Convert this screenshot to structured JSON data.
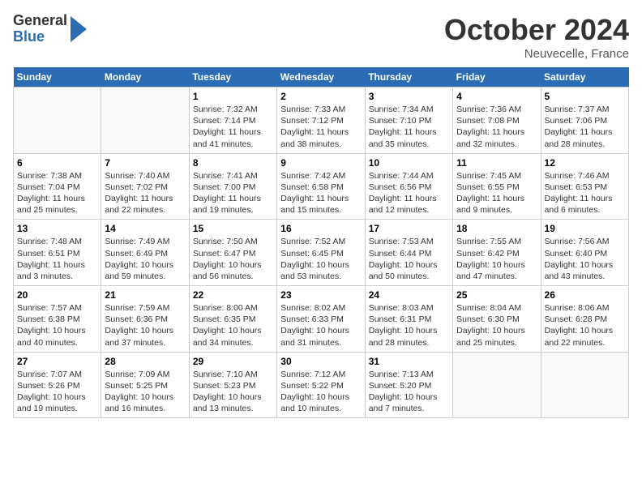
{
  "header": {
    "logo_general": "General",
    "logo_blue": "Blue",
    "month": "October 2024",
    "location": "Neuvecelle, France"
  },
  "days_of_week": [
    "Sunday",
    "Monday",
    "Tuesday",
    "Wednesday",
    "Thursday",
    "Friday",
    "Saturday"
  ],
  "weeks": [
    [
      {
        "day": "",
        "sunrise": "",
        "sunset": "",
        "daylight": ""
      },
      {
        "day": "",
        "sunrise": "",
        "sunset": "",
        "daylight": ""
      },
      {
        "day": "1",
        "sunrise": "Sunrise: 7:32 AM",
        "sunset": "Sunset: 7:14 PM",
        "daylight": "Daylight: 11 hours and 41 minutes."
      },
      {
        "day": "2",
        "sunrise": "Sunrise: 7:33 AM",
        "sunset": "Sunset: 7:12 PM",
        "daylight": "Daylight: 11 hours and 38 minutes."
      },
      {
        "day": "3",
        "sunrise": "Sunrise: 7:34 AM",
        "sunset": "Sunset: 7:10 PM",
        "daylight": "Daylight: 11 hours and 35 minutes."
      },
      {
        "day": "4",
        "sunrise": "Sunrise: 7:36 AM",
        "sunset": "Sunset: 7:08 PM",
        "daylight": "Daylight: 11 hours and 32 minutes."
      },
      {
        "day": "5",
        "sunrise": "Sunrise: 7:37 AM",
        "sunset": "Sunset: 7:06 PM",
        "daylight": "Daylight: 11 hours and 28 minutes."
      }
    ],
    [
      {
        "day": "6",
        "sunrise": "Sunrise: 7:38 AM",
        "sunset": "Sunset: 7:04 PM",
        "daylight": "Daylight: 11 hours and 25 minutes."
      },
      {
        "day": "7",
        "sunrise": "Sunrise: 7:40 AM",
        "sunset": "Sunset: 7:02 PM",
        "daylight": "Daylight: 11 hours and 22 minutes."
      },
      {
        "day": "8",
        "sunrise": "Sunrise: 7:41 AM",
        "sunset": "Sunset: 7:00 PM",
        "daylight": "Daylight: 11 hours and 19 minutes."
      },
      {
        "day": "9",
        "sunrise": "Sunrise: 7:42 AM",
        "sunset": "Sunset: 6:58 PM",
        "daylight": "Daylight: 11 hours and 15 minutes."
      },
      {
        "day": "10",
        "sunrise": "Sunrise: 7:44 AM",
        "sunset": "Sunset: 6:56 PM",
        "daylight": "Daylight: 11 hours and 12 minutes."
      },
      {
        "day": "11",
        "sunrise": "Sunrise: 7:45 AM",
        "sunset": "Sunset: 6:55 PM",
        "daylight": "Daylight: 11 hours and 9 minutes."
      },
      {
        "day": "12",
        "sunrise": "Sunrise: 7:46 AM",
        "sunset": "Sunset: 6:53 PM",
        "daylight": "Daylight: 11 hours and 6 minutes."
      }
    ],
    [
      {
        "day": "13",
        "sunrise": "Sunrise: 7:48 AM",
        "sunset": "Sunset: 6:51 PM",
        "daylight": "Daylight: 11 hours and 3 minutes."
      },
      {
        "day": "14",
        "sunrise": "Sunrise: 7:49 AM",
        "sunset": "Sunset: 6:49 PM",
        "daylight": "Daylight: 10 hours and 59 minutes."
      },
      {
        "day": "15",
        "sunrise": "Sunrise: 7:50 AM",
        "sunset": "Sunset: 6:47 PM",
        "daylight": "Daylight: 10 hours and 56 minutes."
      },
      {
        "day": "16",
        "sunrise": "Sunrise: 7:52 AM",
        "sunset": "Sunset: 6:45 PM",
        "daylight": "Daylight: 10 hours and 53 minutes."
      },
      {
        "day": "17",
        "sunrise": "Sunrise: 7:53 AM",
        "sunset": "Sunset: 6:44 PM",
        "daylight": "Daylight: 10 hours and 50 minutes."
      },
      {
        "day": "18",
        "sunrise": "Sunrise: 7:55 AM",
        "sunset": "Sunset: 6:42 PM",
        "daylight": "Daylight: 10 hours and 47 minutes."
      },
      {
        "day": "19",
        "sunrise": "Sunrise: 7:56 AM",
        "sunset": "Sunset: 6:40 PM",
        "daylight": "Daylight: 10 hours and 43 minutes."
      }
    ],
    [
      {
        "day": "20",
        "sunrise": "Sunrise: 7:57 AM",
        "sunset": "Sunset: 6:38 PM",
        "daylight": "Daylight: 10 hours and 40 minutes."
      },
      {
        "day": "21",
        "sunrise": "Sunrise: 7:59 AM",
        "sunset": "Sunset: 6:36 PM",
        "daylight": "Daylight: 10 hours and 37 minutes."
      },
      {
        "day": "22",
        "sunrise": "Sunrise: 8:00 AM",
        "sunset": "Sunset: 6:35 PM",
        "daylight": "Daylight: 10 hours and 34 minutes."
      },
      {
        "day": "23",
        "sunrise": "Sunrise: 8:02 AM",
        "sunset": "Sunset: 6:33 PM",
        "daylight": "Daylight: 10 hours and 31 minutes."
      },
      {
        "day": "24",
        "sunrise": "Sunrise: 8:03 AM",
        "sunset": "Sunset: 6:31 PM",
        "daylight": "Daylight: 10 hours and 28 minutes."
      },
      {
        "day": "25",
        "sunrise": "Sunrise: 8:04 AM",
        "sunset": "Sunset: 6:30 PM",
        "daylight": "Daylight: 10 hours and 25 minutes."
      },
      {
        "day": "26",
        "sunrise": "Sunrise: 8:06 AM",
        "sunset": "Sunset: 6:28 PM",
        "daylight": "Daylight: 10 hours and 22 minutes."
      }
    ],
    [
      {
        "day": "27",
        "sunrise": "Sunrise: 7:07 AM",
        "sunset": "Sunset: 5:26 PM",
        "daylight": "Daylight: 10 hours and 19 minutes."
      },
      {
        "day": "28",
        "sunrise": "Sunrise: 7:09 AM",
        "sunset": "Sunset: 5:25 PM",
        "daylight": "Daylight: 10 hours and 16 minutes."
      },
      {
        "day": "29",
        "sunrise": "Sunrise: 7:10 AM",
        "sunset": "Sunset: 5:23 PM",
        "daylight": "Daylight: 10 hours and 13 minutes."
      },
      {
        "day": "30",
        "sunrise": "Sunrise: 7:12 AM",
        "sunset": "Sunset: 5:22 PM",
        "daylight": "Daylight: 10 hours and 10 minutes."
      },
      {
        "day": "31",
        "sunrise": "Sunrise: 7:13 AM",
        "sunset": "Sunset: 5:20 PM",
        "daylight": "Daylight: 10 hours and 7 minutes."
      },
      {
        "day": "",
        "sunrise": "",
        "sunset": "",
        "daylight": ""
      },
      {
        "day": "",
        "sunrise": "",
        "sunset": "",
        "daylight": ""
      }
    ]
  ]
}
